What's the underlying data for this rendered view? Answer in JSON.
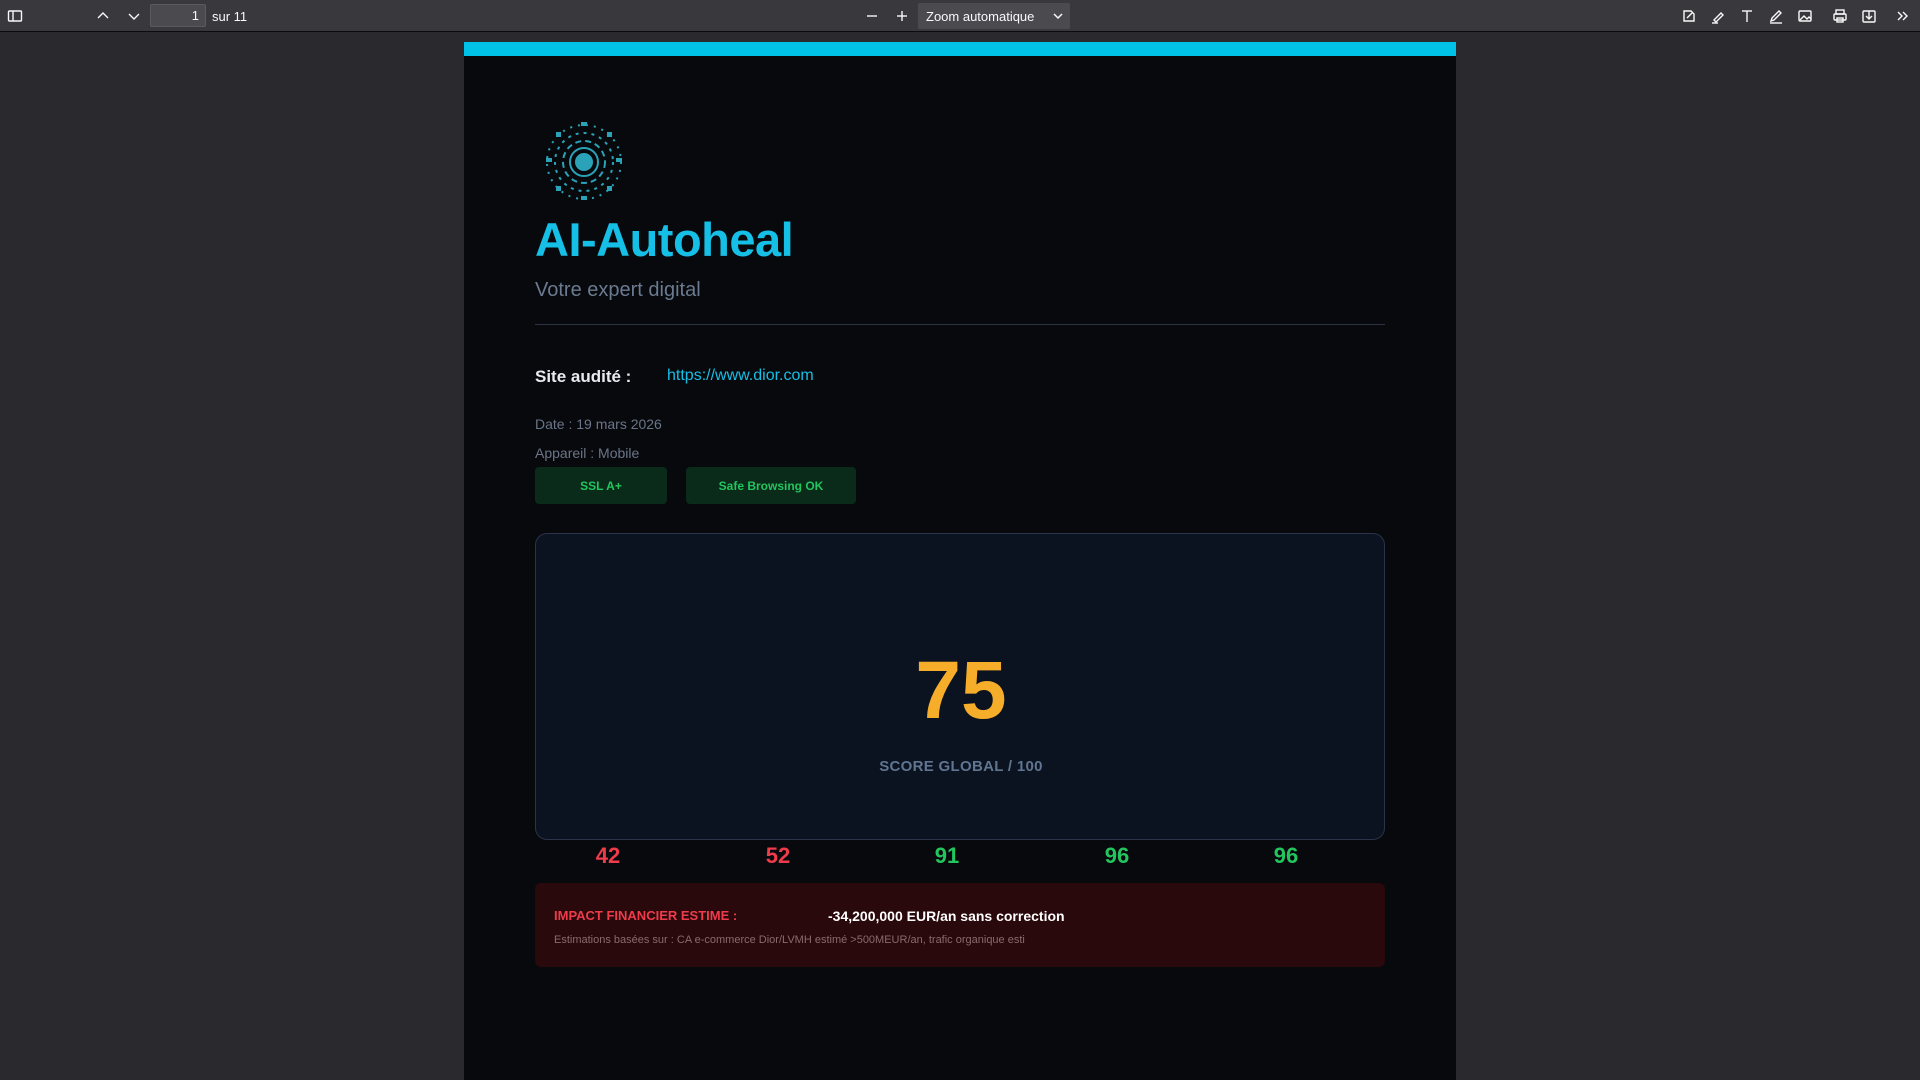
{
  "toolbar": {
    "page_current": "1",
    "page_total": "sur 11",
    "zoom": "Zoom automatique",
    "icons": [
      "sidebar-toggle-icon",
      "chevron-up-icon",
      "chevron-down-icon",
      "zoom-out-icon",
      "zoom-in-icon",
      "signature-icon",
      "highlight-icon",
      "text-icon",
      "draw-icon",
      "image-icon",
      "print-icon",
      "save-icon",
      "more-tools-icon"
    ]
  },
  "report": {
    "title": "AI-Autoheal",
    "subtitle": "Votre expert digital",
    "site_label": "Site audité :",
    "site_url": "https://www.dior.com",
    "date": "Date : 19 mars 2026",
    "device": "Appareil : Mobile",
    "badges": [
      "SSL A+",
      "Safe Browsing OK"
    ],
    "score": "75",
    "score_label": "SCORE GLOBAL / 100",
    "sub_scores": [
      "42",
      "52",
      "91",
      "96",
      "96"
    ],
    "impact_label": "IMPACT FINANCIER ESTIME :",
    "impact_value": "-34,200,000 EUR/an sans correction",
    "impact_note": "Estimations basées sur : CA e-commerce Dior/LVMH estimé >500MEUR/an, trafic organique esti"
  },
  "colors": {
    "accent": "#16bfe6",
    "score": "#f5ad2a",
    "bad": "#ef3b4a",
    "good": "#22c55e"
  }
}
